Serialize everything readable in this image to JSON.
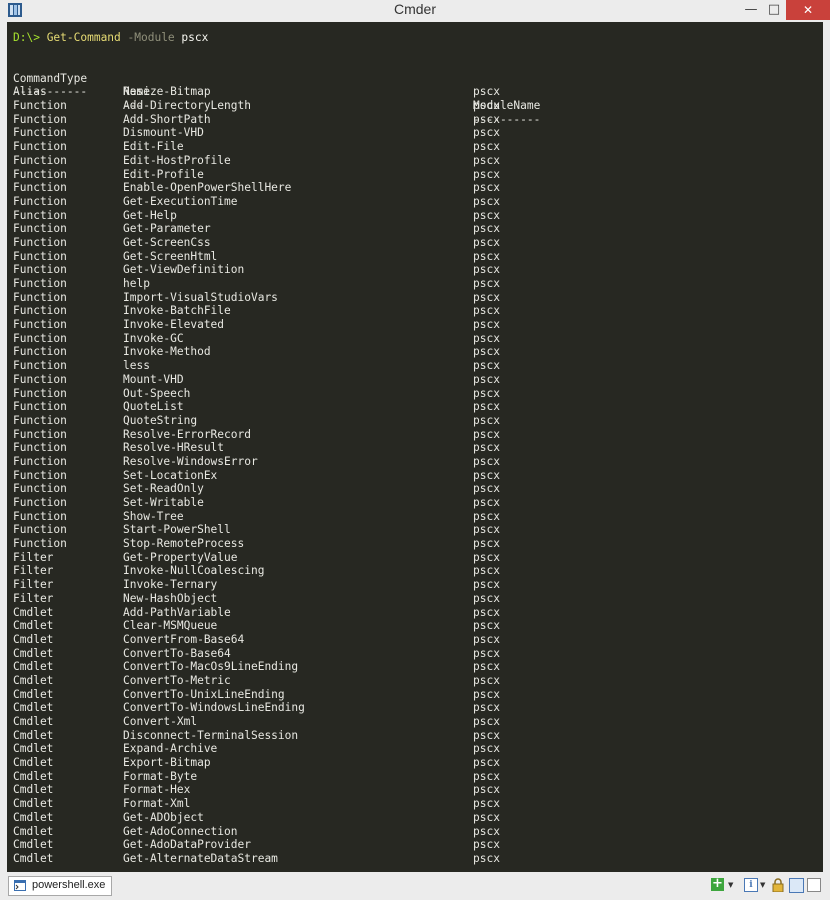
{
  "window": {
    "title": "Cmder",
    "min_glyph": "—",
    "max_glyph": "□",
    "close_glyph": "✕"
  },
  "prompt": {
    "path": "D:\\> ",
    "command": "Get-Command ",
    "parameter": "-Module ",
    "argument": "pscx"
  },
  "output": {
    "headers": [
      "CommandType",
      "Name",
      "ModuleName"
    ],
    "underlines": [
      "-----------",
      "----",
      "----------"
    ],
    "rows": [
      [
        "Alias",
        "Resize-Bitmap",
        "pscx"
      ],
      [
        "Function",
        "Add-DirectoryLength",
        "pscx"
      ],
      [
        "Function",
        "Add-ShortPath",
        "pscx"
      ],
      [
        "Function",
        "Dismount-VHD",
        "pscx"
      ],
      [
        "Function",
        "Edit-File",
        "pscx"
      ],
      [
        "Function",
        "Edit-HostProfile",
        "pscx"
      ],
      [
        "Function",
        "Edit-Profile",
        "pscx"
      ],
      [
        "Function",
        "Enable-OpenPowerShellHere",
        "pscx"
      ],
      [
        "Function",
        "Get-ExecutionTime",
        "pscx"
      ],
      [
        "Function",
        "Get-Help",
        "pscx"
      ],
      [
        "Function",
        "Get-Parameter",
        "pscx"
      ],
      [
        "Function",
        "Get-ScreenCss",
        "pscx"
      ],
      [
        "Function",
        "Get-ScreenHtml",
        "pscx"
      ],
      [
        "Function",
        "Get-ViewDefinition",
        "pscx"
      ],
      [
        "Function",
        "help",
        "pscx"
      ],
      [
        "Function",
        "Import-VisualStudioVars",
        "pscx"
      ],
      [
        "Function",
        "Invoke-BatchFile",
        "pscx"
      ],
      [
        "Function",
        "Invoke-Elevated",
        "pscx"
      ],
      [
        "Function",
        "Invoke-GC",
        "pscx"
      ],
      [
        "Function",
        "Invoke-Method",
        "pscx"
      ],
      [
        "Function",
        "less",
        "pscx"
      ],
      [
        "Function",
        "Mount-VHD",
        "pscx"
      ],
      [
        "Function",
        "Out-Speech",
        "pscx"
      ],
      [
        "Function",
        "QuoteList",
        "pscx"
      ],
      [
        "Function",
        "QuoteString",
        "pscx"
      ],
      [
        "Function",
        "Resolve-ErrorRecord",
        "pscx"
      ],
      [
        "Function",
        "Resolve-HResult",
        "pscx"
      ],
      [
        "Function",
        "Resolve-WindowsError",
        "pscx"
      ],
      [
        "Function",
        "Set-LocationEx",
        "pscx"
      ],
      [
        "Function",
        "Set-ReadOnly",
        "pscx"
      ],
      [
        "Function",
        "Set-Writable",
        "pscx"
      ],
      [
        "Function",
        "Show-Tree",
        "pscx"
      ],
      [
        "Function",
        "Start-PowerShell",
        "pscx"
      ],
      [
        "Function",
        "Stop-RemoteProcess",
        "pscx"
      ],
      [
        "Filter",
        "Get-PropertyValue",
        "pscx"
      ],
      [
        "Filter",
        "Invoke-NullCoalescing",
        "pscx"
      ],
      [
        "Filter",
        "Invoke-Ternary",
        "pscx"
      ],
      [
        "Filter",
        "New-HashObject",
        "pscx"
      ],
      [
        "Cmdlet",
        "Add-PathVariable",
        "pscx"
      ],
      [
        "Cmdlet",
        "Clear-MSMQueue",
        "pscx"
      ],
      [
        "Cmdlet",
        "ConvertFrom-Base64",
        "pscx"
      ],
      [
        "Cmdlet",
        "ConvertTo-Base64",
        "pscx"
      ],
      [
        "Cmdlet",
        "ConvertTo-MacOs9LineEnding",
        "pscx"
      ],
      [
        "Cmdlet",
        "ConvertTo-Metric",
        "pscx"
      ],
      [
        "Cmdlet",
        "ConvertTo-UnixLineEnding",
        "pscx"
      ],
      [
        "Cmdlet",
        "ConvertTo-WindowsLineEnding",
        "pscx"
      ],
      [
        "Cmdlet",
        "Convert-Xml",
        "pscx"
      ],
      [
        "Cmdlet",
        "Disconnect-TerminalSession",
        "pscx"
      ],
      [
        "Cmdlet",
        "Expand-Archive",
        "pscx"
      ],
      [
        "Cmdlet",
        "Export-Bitmap",
        "pscx"
      ],
      [
        "Cmdlet",
        "Format-Byte",
        "pscx"
      ],
      [
        "Cmdlet",
        "Format-Hex",
        "pscx"
      ],
      [
        "Cmdlet",
        "Format-Xml",
        "pscx"
      ],
      [
        "Cmdlet",
        "Get-ADObject",
        "pscx"
      ],
      [
        "Cmdlet",
        "Get-AdoConnection",
        "pscx"
      ],
      [
        "Cmdlet",
        "Get-AdoDataProvider",
        "pscx"
      ],
      [
        "Cmdlet",
        "Get-AlternateDataStream",
        "pscx"
      ]
    ]
  },
  "statusbar": {
    "tab_label": "powershell.exe",
    "plus_glyph": "+",
    "dropdown_glyph": "▼",
    "info_glyph": "i"
  },
  "colors": {
    "terminal_bg": "#272822",
    "prompt_path": "#a6e22e",
    "prompt_command": "#e6db74",
    "close_button": "#c9413b"
  }
}
